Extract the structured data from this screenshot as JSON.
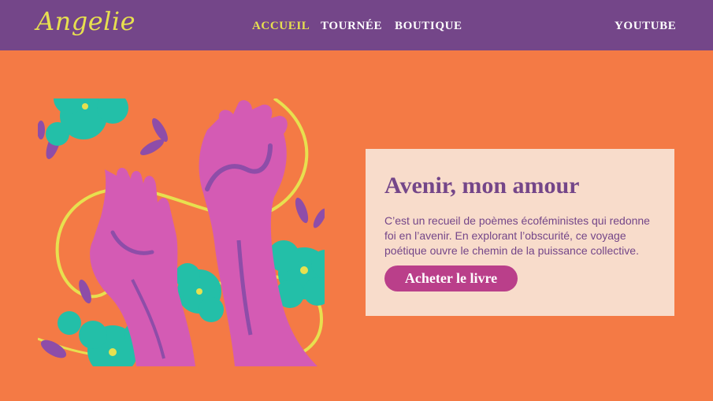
{
  "brand": {
    "logo": "Angelie"
  },
  "nav": {
    "items": [
      {
        "label": "ACCUEIL",
        "active": true
      },
      {
        "label": "TOURNÉE",
        "active": false
      },
      {
        "label": "BOUTIQUE",
        "active": false
      }
    ],
    "youtube": "YOUTUBE"
  },
  "hero": {
    "title": "Avenir, mon amour",
    "description": "C’est un recueil de poèmes écoféministes qui redonne foi en l’avenir. En explorant l’obscurité, ce voyage poétique ouvre le chemin de la puissance collective.",
    "cta": "Acheter le livre"
  },
  "colors": {
    "background": "#F47A45",
    "header": "#744689",
    "accent_yellow": "#E7E04F",
    "card": "#F8DCCB",
    "button": "#BA3F8A",
    "flower": "#23BFA8",
    "hand": "#D45BB4"
  },
  "illustration": {
    "icon": "hands-and-flowers-illustration"
  }
}
